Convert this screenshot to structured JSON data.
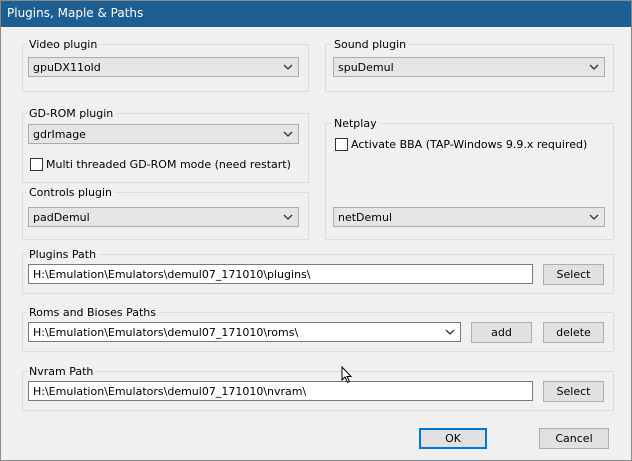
{
  "window": {
    "title": "Plugins, Maple & Paths"
  },
  "video": {
    "label": "Video plugin",
    "value": "gpuDX11old"
  },
  "sound": {
    "label": "Sound plugin",
    "value": "spuDemul"
  },
  "gdrom": {
    "label": "GD-ROM plugin",
    "value": "gdrImage",
    "checkbox_label": "Multi threaded GD-ROM mode (need restart)"
  },
  "netplay": {
    "label": "Netplay",
    "checkbox_label": "Activate BBA (TAP-Windows 9.9.x required)",
    "value": "netDemul"
  },
  "controls": {
    "label": "Controls plugin",
    "value": "padDemul"
  },
  "plugins_path": {
    "label": "Plugins Path",
    "value": "H:\\Emulation\\Emulators\\demul07_171010\\plugins\\",
    "select_label": "Select"
  },
  "roms_paths": {
    "label": "Roms and Bioses Paths",
    "value": "H:\\Emulation\\Emulators\\demul07_171010\\roms\\",
    "add_label": "add",
    "delete_label": "delete"
  },
  "nvram_path": {
    "label": "Nvram Path",
    "value": "H:\\Emulation\\Emulators\\demul07_171010\\nvram\\",
    "select_label": "Select"
  },
  "dialog": {
    "ok_label": "OK",
    "cancel_label": "Cancel"
  },
  "colors": {
    "titlebar": "#1e5f93",
    "accent": "#0078d7"
  },
  "icons": {
    "dropdown": "chevron-down-icon",
    "cursor": "mouse-pointer-icon"
  }
}
